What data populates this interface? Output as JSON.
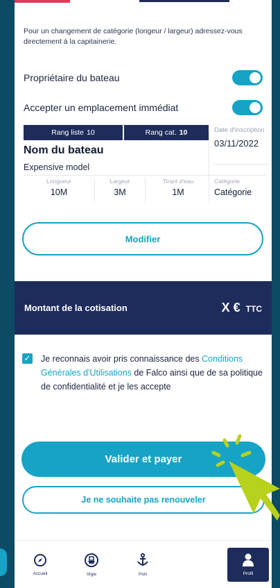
{
  "info": {
    "text": "Pour un changement de catégorie (longeur / largeur) adressez-vous directement à la capitainerie."
  },
  "toggles": [
    {
      "label": "Propriétaire du bateau",
      "on": true
    },
    {
      "label": "Accepter un emplacement immédiat",
      "on": true
    }
  ],
  "boat": {
    "rang_liste_label": "Rang liste",
    "rang_liste_value": "10",
    "rang_cat_label": "Rang cat.",
    "rang_cat_value": "10",
    "name": "Nom du bateau",
    "model": "Expensive model",
    "date_label": "Date d'inscription",
    "date_value": "03/11/2022",
    "specs": [
      {
        "label": "Longueur",
        "value": "10M"
      },
      {
        "label": "Largeur",
        "value": "3M"
      },
      {
        "label": "Tirant d'eau",
        "value": "1M"
      }
    ],
    "category_label": "Catégorie",
    "category_value": "Catégorie"
  },
  "buttons": {
    "modifier": "Modifier",
    "pay": "Valider et payer",
    "no_renew": "Je ne souhaite pas renouveler"
  },
  "price": {
    "title": "Montant de la cotisation",
    "amount": "X €",
    "suffix": "TTC"
  },
  "consent": {
    "checked": true,
    "text_before": "Je reconnais avoir pris connaissance des",
    "link": "Conditions Générales d'Utilisations",
    "text_after": "de Falco ainsi que de sa politique de confidentialité et je les accepte"
  },
  "tabs": [
    {
      "label": "Accueil",
      "icon": "compass-icon"
    },
    {
      "label": "Vigie",
      "icon": "boat-icon"
    },
    {
      "label": "Port",
      "icon": "anchor-icon"
    },
    {
      "label": "Profil",
      "icon": "user-icon",
      "active": true
    }
  ],
  "colors": {
    "accent": "#17a3c6",
    "navy": "#1e2c5c",
    "background": "#0d4a63",
    "cursor": "#b8d11c"
  }
}
